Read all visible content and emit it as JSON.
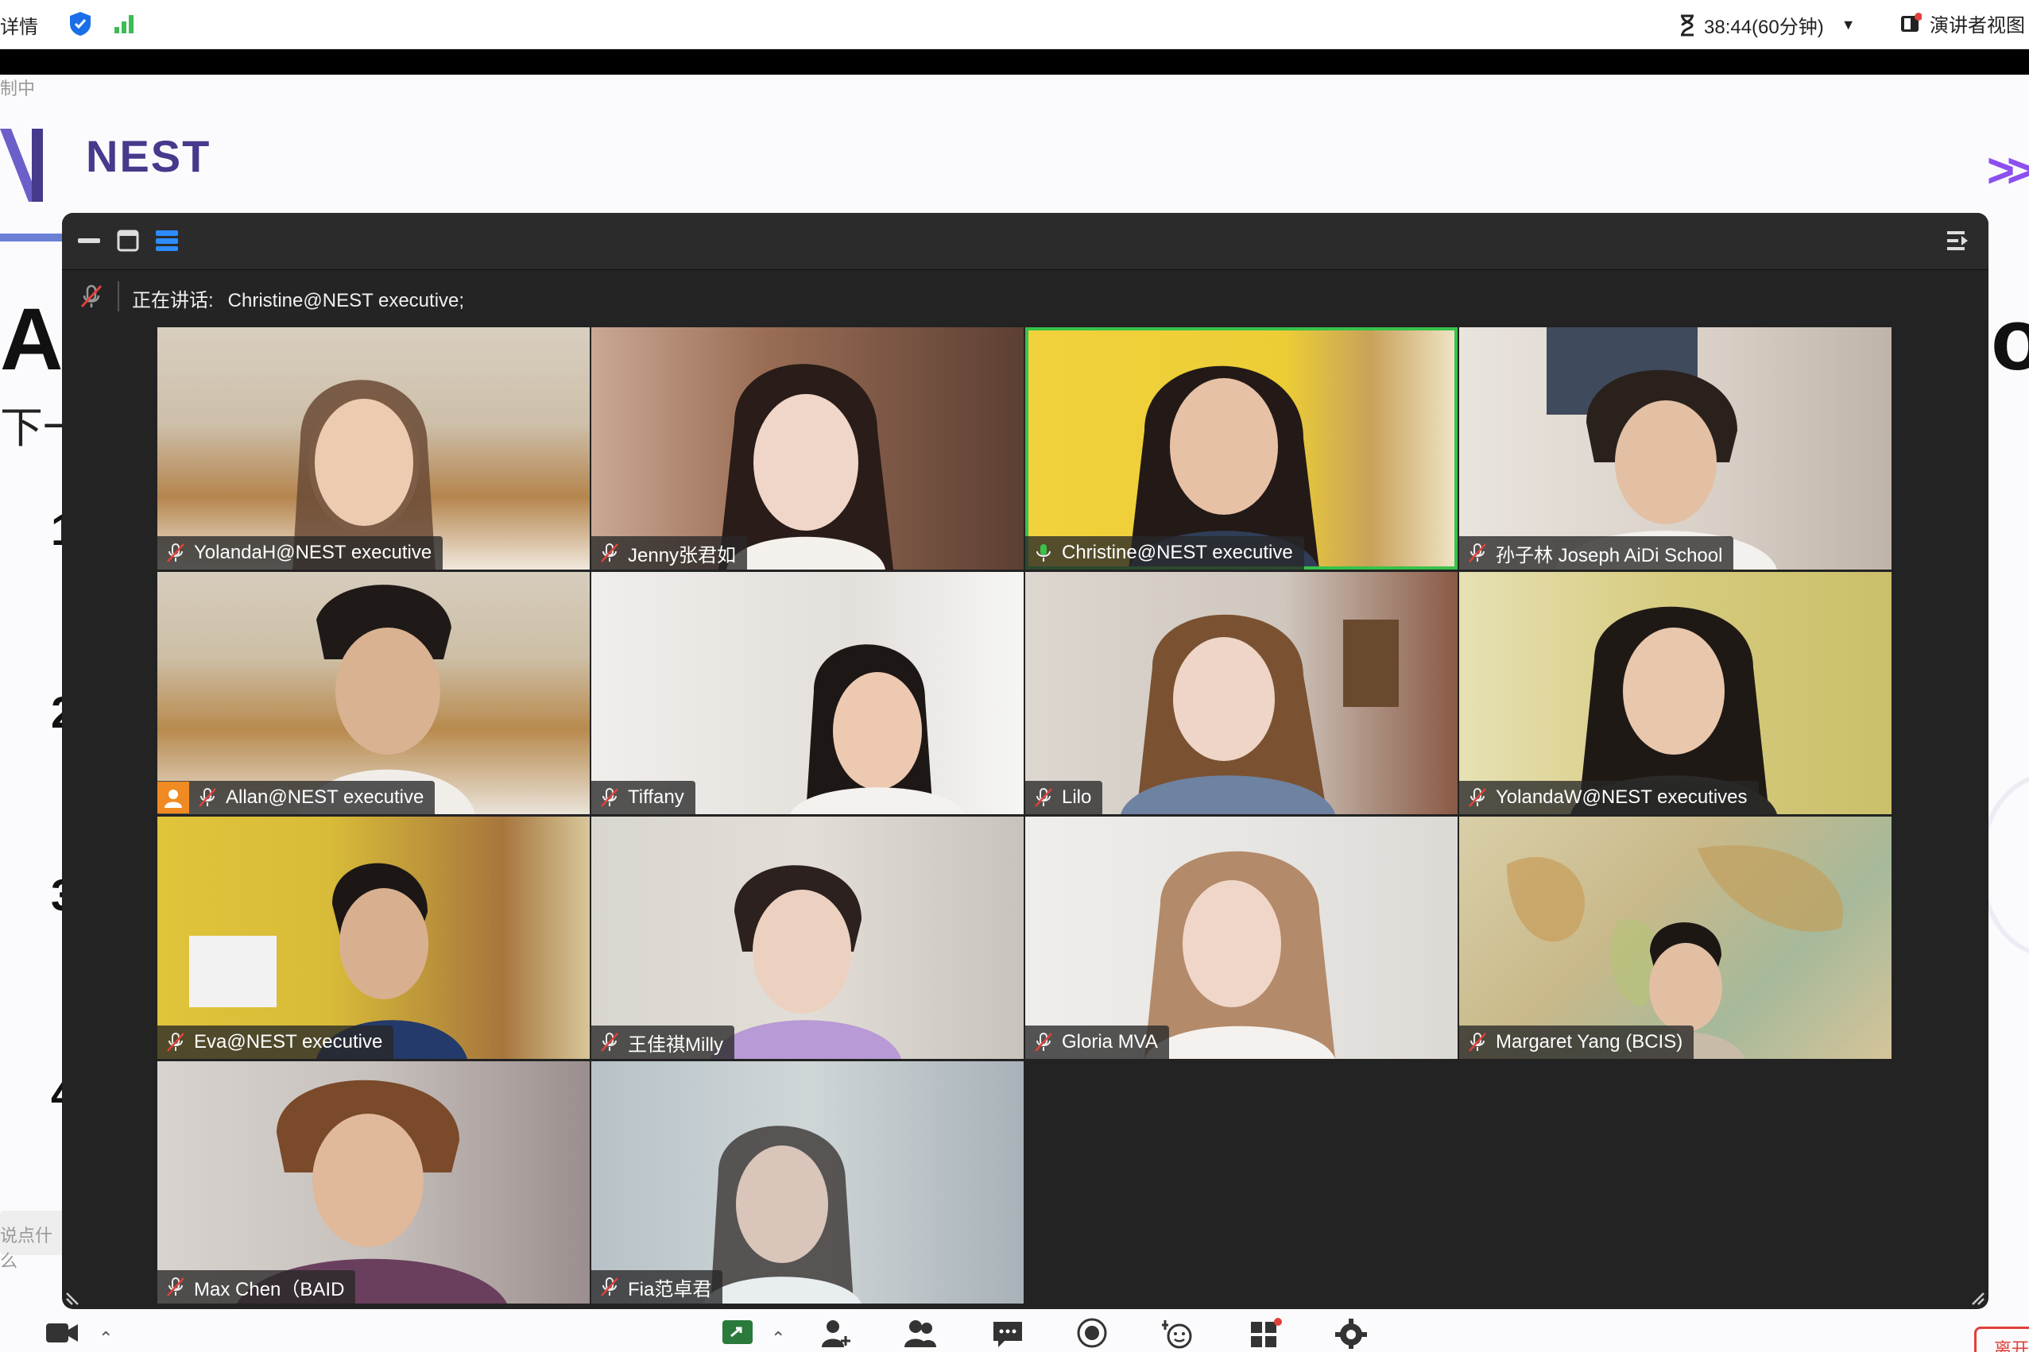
{
  "topbar": {
    "details_label": "详情",
    "timer": "38:44(60分钟)",
    "view_label": "演讲者视图",
    "colors": {
      "shield": "#1a6fe8",
      "signal": "#3dbb54"
    }
  },
  "slide": {
    "corner_text": "制中",
    "brand": "NEST",
    "chevron": ">>",
    "heading_left": "Ac",
    "heading_right": "ol",
    "subline": "下一",
    "numbers": [
      "1",
      "2",
      "3",
      "4"
    ],
    "chat_stub": "说点什么",
    "colors": {
      "brand": "#453a8c",
      "accent": "#8c4ff0"
    }
  },
  "window": {
    "speaking_label": "正在讲话:",
    "speaking_name": "Christine@NEST executive;"
  },
  "participants": [
    {
      "name": "YolandaH@NEST executive",
      "muted": true,
      "active": false
    },
    {
      "name": "Jenny张君如",
      "muted": true,
      "active": false
    },
    {
      "name": "Christine@NEST executive",
      "muted": false,
      "active": true
    },
    {
      "name": "孙子林 Joseph AiDi School",
      "muted": true,
      "active": false
    },
    {
      "name": "Allan@NEST executive",
      "muted": true,
      "active": false,
      "avatar": true
    },
    {
      "name": "Tiffany",
      "muted": true,
      "active": false
    },
    {
      "name": "Lilo",
      "muted": true,
      "active": false
    },
    {
      "name": "YolandaW@NEST executives",
      "muted": true,
      "active": false
    },
    {
      "name": "Eva@NEST executive",
      "muted": true,
      "active": false
    },
    {
      "name": "王佳祺Milly",
      "muted": true,
      "active": false
    },
    {
      "name": "Gloria MVA",
      "muted": true,
      "active": false
    },
    {
      "name": "Margaret Yang (BCIS)",
      "muted": true,
      "active": false
    },
    {
      "name": "Max Chen（BAID",
      "muted": true,
      "active": false
    },
    {
      "name": "Fia范卓君",
      "muted": true,
      "active": false
    }
  ],
  "toolbar": {
    "icons": [
      "video-camera-icon",
      "share-screen-icon",
      "participants-add-icon",
      "participants-icon",
      "chat-icon",
      "record-icon",
      "reactions-icon",
      "apps-icon",
      "settings-icon"
    ],
    "end_label": "离开"
  }
}
